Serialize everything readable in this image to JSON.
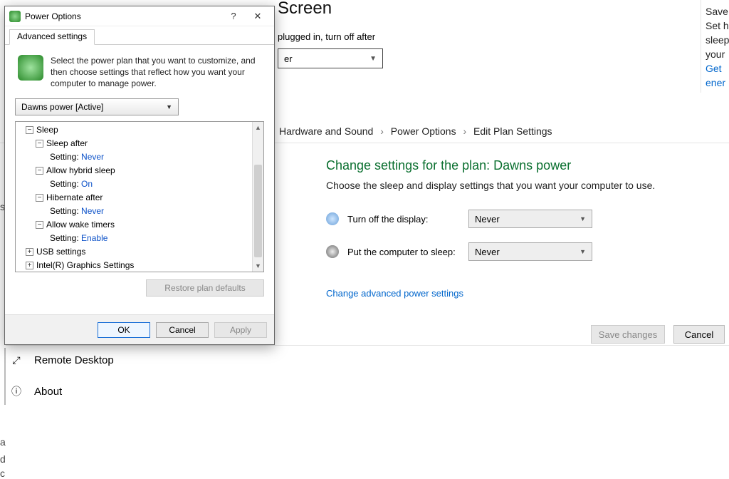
{
  "stray": {
    "a": "s",
    "b": "a",
    "c": "d",
    "d": "c"
  },
  "bg": {
    "headingFrag": "Screen",
    "label": "plugged in, turn off after",
    "selectValue": "er",
    "right": {
      "a": "Save",
      "b": "Set h",
      "c": "sleep",
      "d": "your",
      "e": "Get",
      "f": "ener"
    },
    "crumbs": {
      "hs": "Hardware and Sound",
      "po": "Power Options",
      "eps": "Edit Plan Settings"
    },
    "planHead": "Change settings for the plan: Dawns power",
    "planSub": "Choose the sleep and display settings that you want your computer to use.",
    "row1": {
      "label": "Turn off the display:",
      "value": "Never"
    },
    "row2": {
      "label": "Put the computer to sleep:",
      "value": "Never"
    },
    "advLink": "Change advanced power settings",
    "save": "Save changes",
    "cancel": "Cancel",
    "sidebar": {
      "rd": "Remote Desktop",
      "ab": "About"
    }
  },
  "dlg": {
    "title": "Power Options",
    "tab": "Advanced settings",
    "hint": "Select the power plan that you want to customize, and then choose settings that reflect how you want your computer to manage power.",
    "plan": "Dawns power [Active]",
    "tree": {
      "sleep": "Sleep",
      "sa": "Sleep after",
      "saS": "Setting:",
      "saV": "Never",
      "ah": "Allow hybrid sleep",
      "ahS": "Setting:",
      "ahV": "On",
      "hib": "Hibernate after",
      "hibS": "Setting:",
      "hibV": "Never",
      "awt": "Allow wake timers",
      "awtS": "Setting:",
      "awtV": "Enable",
      "usb": "USB settings",
      "gfx": "Intel(R) Graphics Settings"
    },
    "restore": "Restore plan defaults",
    "ok": "OK",
    "cancel": "Cancel",
    "apply": "Apply"
  }
}
